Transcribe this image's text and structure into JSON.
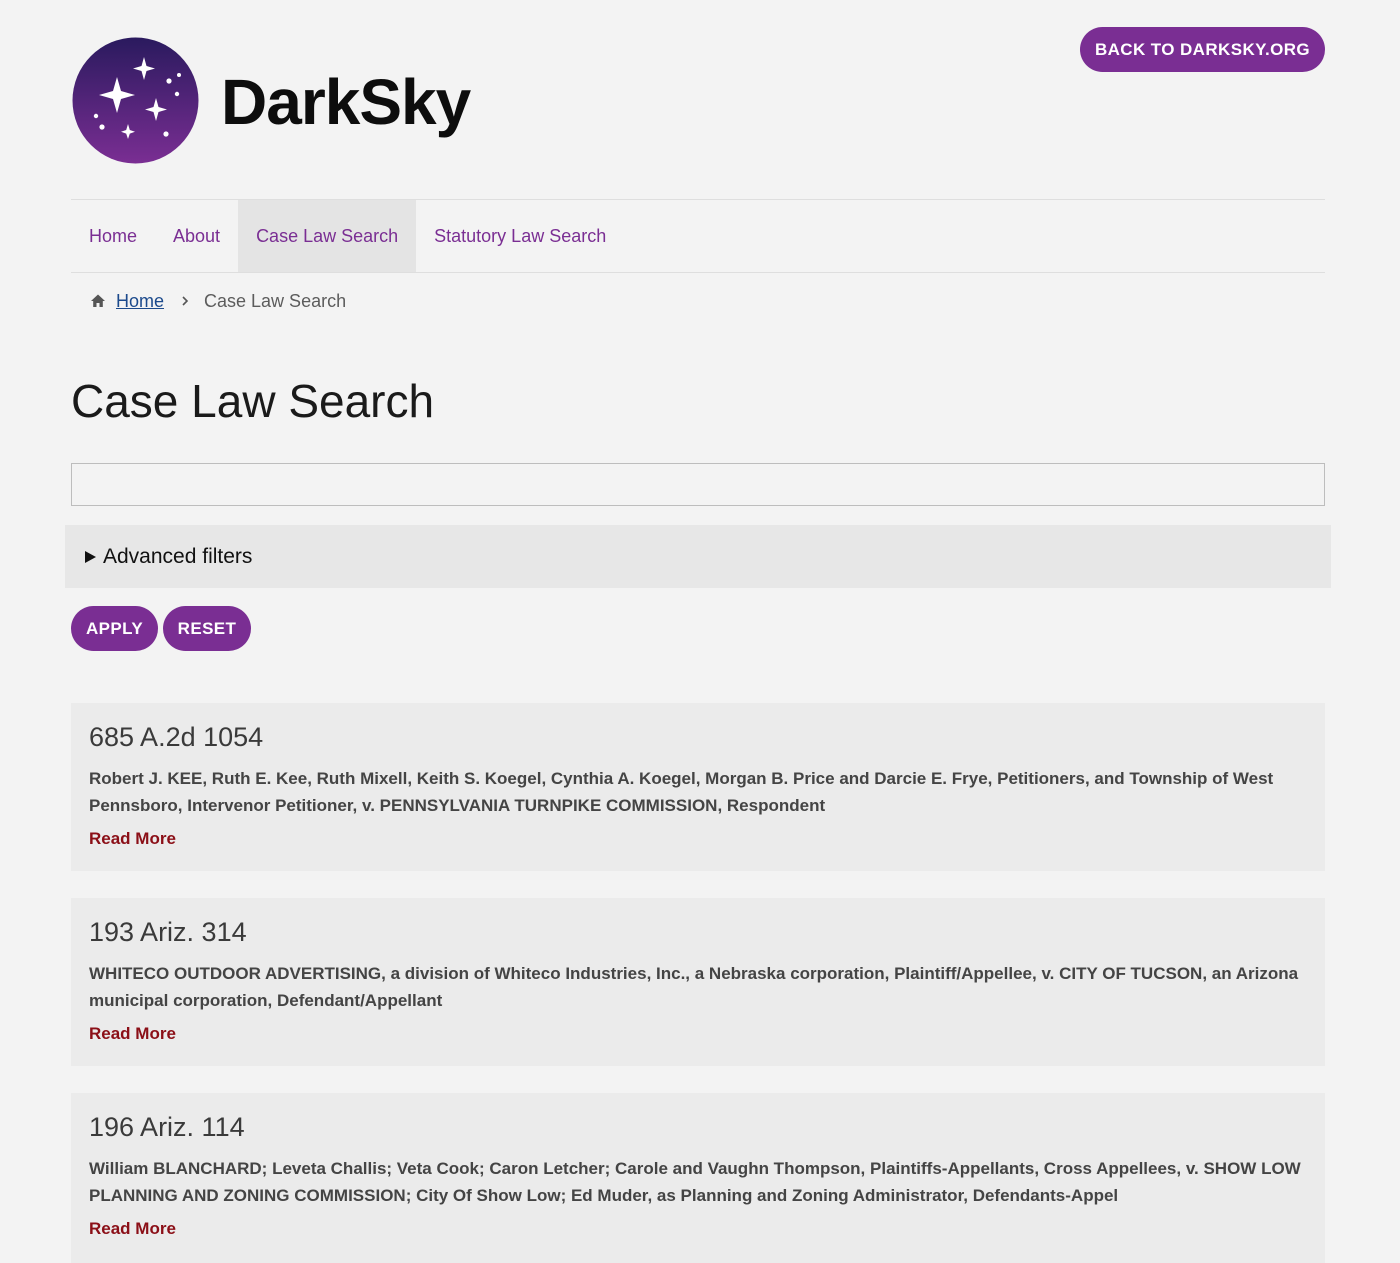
{
  "header": {
    "brand": "DarkSky",
    "back_link": "BACK TO DARKSKY.ORG",
    "logo_colors": {
      "top": "#2a1a5e",
      "bottom": "#7a2e93"
    }
  },
  "nav": {
    "items": [
      {
        "label": "Home"
      },
      {
        "label": "About"
      },
      {
        "label": "Case Law Search",
        "active": true
      },
      {
        "label": "Statutory Law Search"
      }
    ]
  },
  "breadcrumb": {
    "home": "Home",
    "current": "Case Law Search"
  },
  "page": {
    "title": "Case Law Search"
  },
  "search": {
    "value": "",
    "placeholder": ""
  },
  "filters": {
    "label": "Advanced filters",
    "expanded": false
  },
  "actions": {
    "apply": "APPLY",
    "reset": "RESET"
  },
  "results": [
    {
      "citation": "685 A.2d 1054",
      "parties": "Robert J. KEE, Ruth E. Kee, Ruth Mixell, Keith S. Koegel, Cynthia A. Koegel, Morgan B. Price and Darcie E. Frye, Petitioners, and Township of West Pennsboro, Intervenor Petitioner, v. PENNSYLVANIA TURNPIKE COMMISSION, Respondent",
      "link": "Read More"
    },
    {
      "citation": "193 Ariz. 314",
      "parties": "WHITECO OUTDOOR ADVERTISING, a division of Whiteco Industries, Inc., a Nebraska corporation, Plaintiff/Appellee, v. CITY OF TUCSON, an Arizona municipal corporation, Defendant/Appellant",
      "link": "Read More"
    },
    {
      "citation": "196 Ariz. 114",
      "parties": "William BLANCHARD; Leveta Challis; Veta Cook; Caron Letcher; Carole and Vaughn Thompson, Plaintiffs-Appellants, Cross Appellees, v. SHOW LOW PLANNING AND ZONING COMMISSION; City Of Show Low; Ed Muder, as Planning and Zoning Administrator, Defendants-Appel",
      "link": "Read More"
    }
  ],
  "colors": {
    "accent": "#7a2e93",
    "link": "#1c4a8c",
    "read_more": "#8b0f17",
    "background": "#f3f3f3"
  }
}
